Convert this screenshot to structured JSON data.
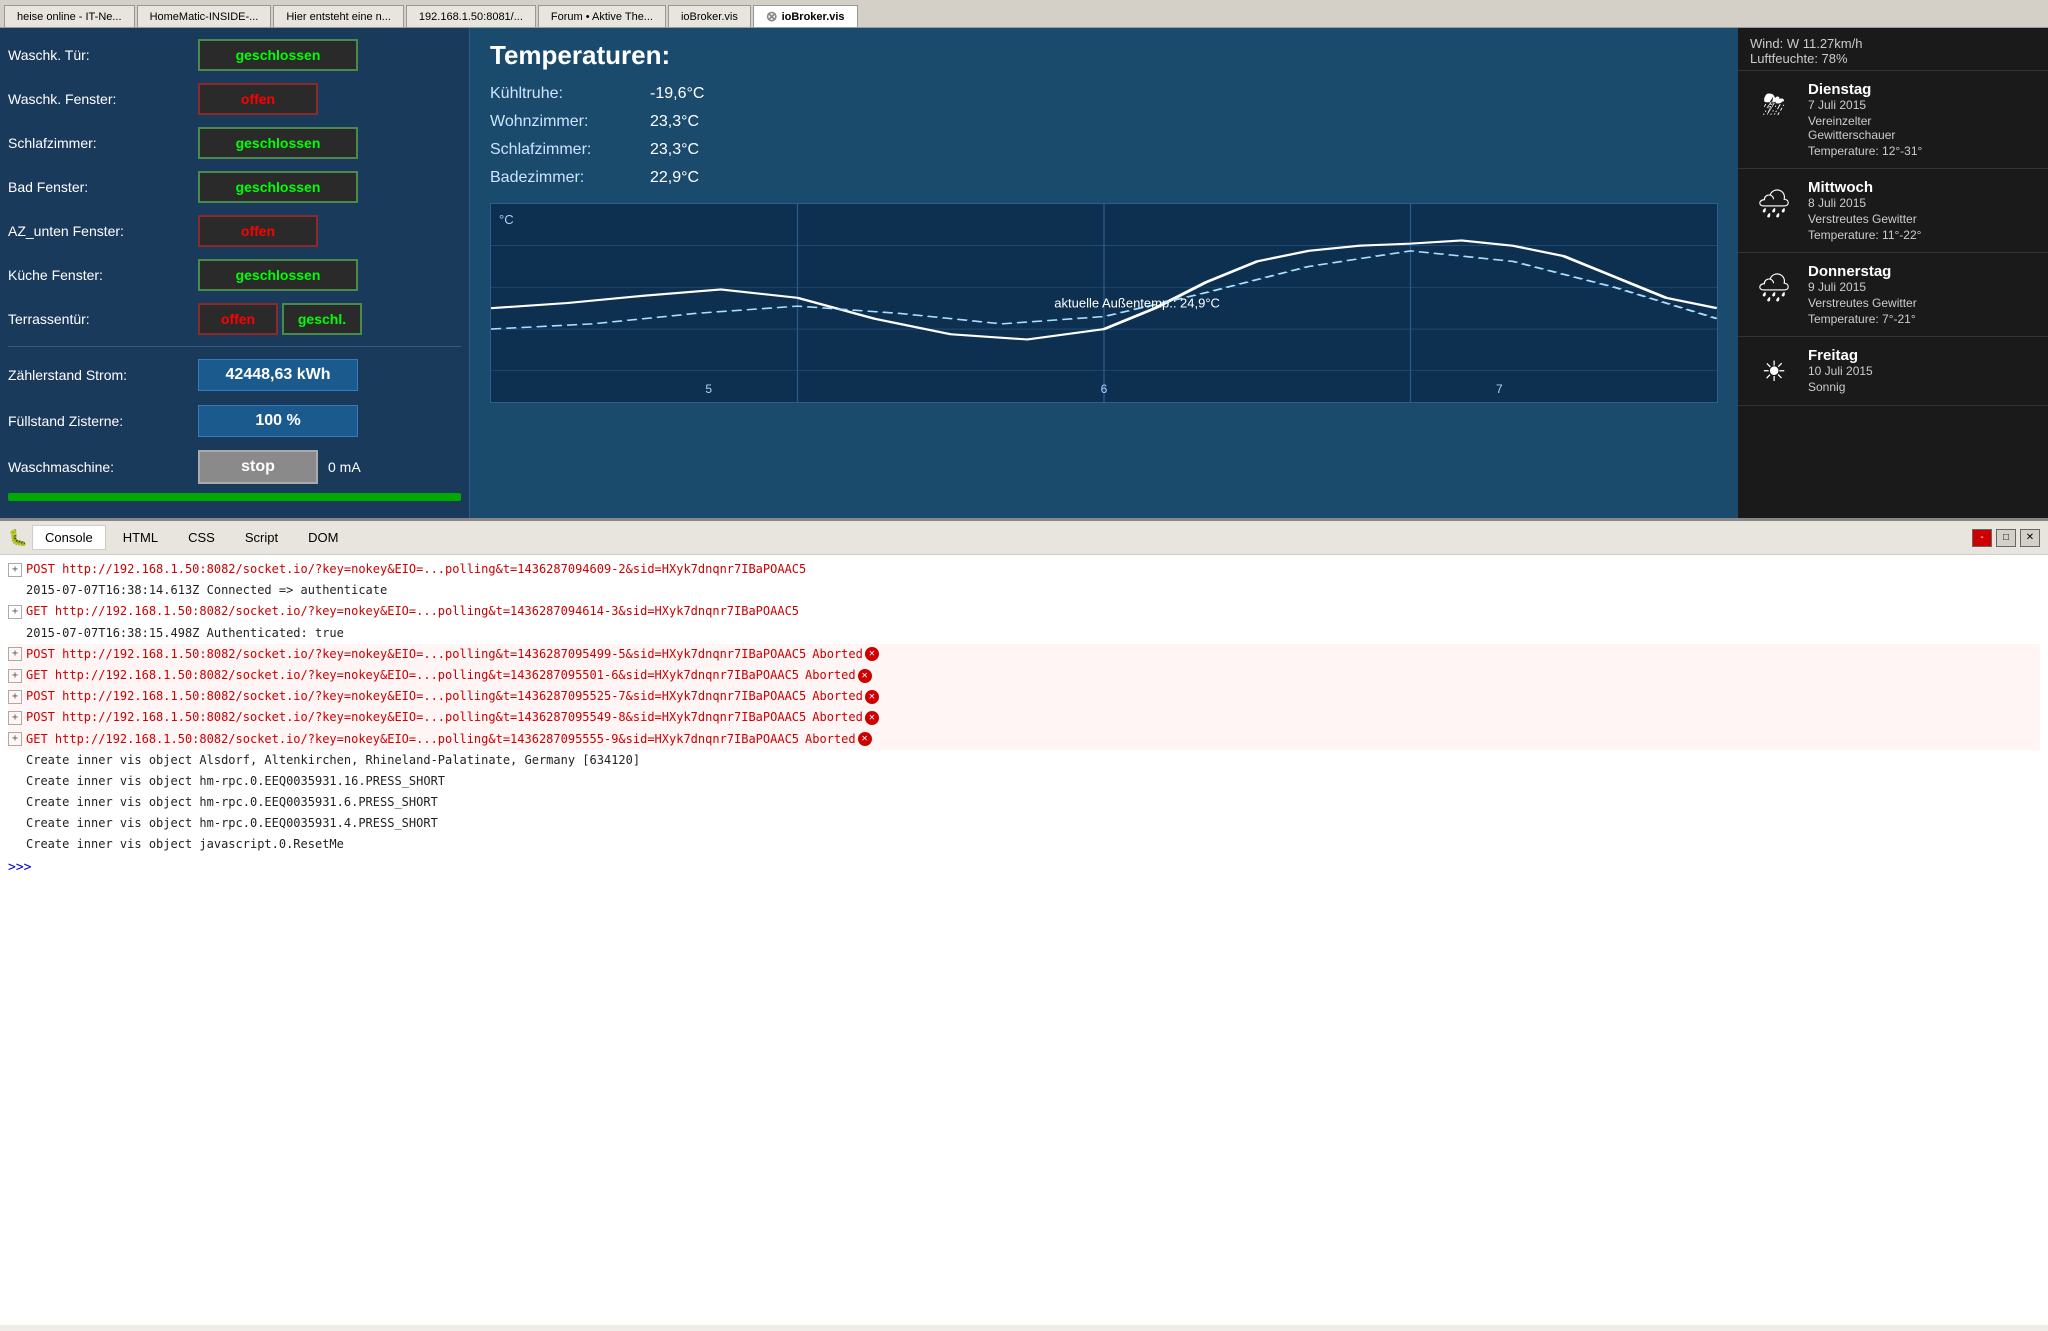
{
  "browser_tabs": [
    {
      "label": "heise online - IT-Ne...",
      "active": false
    },
    {
      "label": "HomeMatic-INSIDE-...",
      "active": false
    },
    {
      "label": "Hier entsteht eine n...",
      "active": false
    },
    {
      "label": "192.168.1.50:8081/...",
      "active": false
    },
    {
      "label": "Forum • Aktive The...",
      "active": false
    },
    {
      "label": "ioBroker.vis",
      "active": false
    },
    {
      "label": "ioBroker.vis",
      "active": true
    }
  ],
  "smart_home": {
    "controls": [
      {
        "label": "Waschk. Tür:",
        "status": "geschlossen",
        "type": "green"
      },
      {
        "label": "Waschk. Fenster:",
        "status": "offen",
        "type": "red"
      },
      {
        "label": "Schlafzimmer:",
        "status": "geschlossen",
        "type": "green"
      },
      {
        "label": "Bad Fenster:",
        "status": "geschlossen",
        "type": "green"
      },
      {
        "label": "AZ_unten Fenster:",
        "status": "offen",
        "type": "red"
      },
      {
        "label": "Küche Fenster:",
        "status": "geschlossen",
        "type": "green"
      },
      {
        "label": "Terrassentür:",
        "btn1": "offen",
        "btn1type": "red",
        "btn2": "geschl.",
        "btn2type": "green",
        "type": "pair"
      }
    ],
    "values": [
      {
        "label": "Zählerstand Strom:",
        "value": "42448,63 kWh"
      },
      {
        "label": "Füllstand Zisterne:",
        "value": "100 %"
      },
      {
        "label": "Waschmaschine:",
        "btn_label": "stop",
        "extra": "0 mA",
        "type": "stop"
      }
    ]
  },
  "temperatures": {
    "title": "Temperaturen:",
    "items": [
      {
        "name": "Kühltruhe:",
        "value": "-19,6°C"
      },
      {
        "name": "Wohnzimmer:",
        "value": "23,3°C"
      },
      {
        "name": "Schlafzimmer:",
        "value": "23,3°C"
      },
      {
        "name": "Badezimmer:",
        "value": "22,9°C"
      }
    ],
    "chart": {
      "y_label": "°C",
      "overlay_text": "aktuelle Außentemp.: 24,9°C",
      "x_labels": [
        "5",
        "6",
        "7"
      ]
    }
  },
  "weather": {
    "wind_line": "Wind: W 11.27km/h",
    "humidity_line": "Luftfeuchte: 78%",
    "days": [
      {
        "name": "Dienstag",
        "date": "7 Juli 2015",
        "desc": "Vereinzelter\nGewitterschauer",
        "temp": "Temperature: 12°-31°",
        "icon": "⛈"
      },
      {
        "name": "Mittwoch",
        "date": "8 Juli 2015",
        "desc": "Verstreutes Gewitter",
        "temp": "Temperature: 11°-22°",
        "icon": "🌧"
      },
      {
        "name": "Donnerstag",
        "date": "9 Juli 2015",
        "desc": "Verstreutes Gewitter",
        "temp": "Temperature: 7°-21°",
        "icon": "🌧"
      },
      {
        "name": "Freitag",
        "date": "10 Juli 2015",
        "desc": "Sonnig",
        "temp": "",
        "icon": "☀"
      }
    ]
  },
  "devtools": {
    "tabs": [
      "Console",
      "HTML",
      "CSS",
      "Script",
      "DOM"
    ],
    "active_tab": "Console",
    "window_buttons": [
      "-",
      "□",
      "✕"
    ],
    "log_entries": [
      {
        "type": "post",
        "method": "POST",
        "url": "http://192.168.1.50:8082/socket.io/?key=nokey&EIO=...polling&t=1436287094609-2&sid=HXyk7dnqnr7IBaPOAAC5",
        "aborted": false
      },
      {
        "type": "info",
        "text": "2015-07-07T16:38:14.613Z Connected => authenticate",
        "aborted": false
      },
      {
        "type": "get",
        "method": "GET",
        "url": "http://192.168.1.50:8082/socket.io/?key=nokey&EIO=...polling&t=1436287094614-3&sid=HXyk7dnqnr7IBaPOAAC5",
        "aborted": false
      },
      {
        "type": "info",
        "text": "2015-07-07T16:38:15.498Z Authenticated: true",
        "aborted": false
      },
      {
        "type": "post",
        "method": "POST",
        "url": "http://192.168.1.50:8082/socket.io/?key=nokey&EIO=...polling&t=1436287095499-5&sid=HXyk7dnqnr7IBaPOAAC5",
        "aborted": true
      },
      {
        "type": "get",
        "method": "GET",
        "url": "http://192.168.1.50:8082/socket.io/?key=nokey&EIO=...polling&t=1436287095501-6&sid=HXyk7dnqnr7IBaPOAAC5",
        "aborted": true
      },
      {
        "type": "post",
        "method": "POST",
        "url": "http://192.168.1.50:8082/socket.io/?key=nokey&EIO=...polling&t=1436287095525-7&sid=HXyk7dnqnr7IBaPOAAC5",
        "aborted": true
      },
      {
        "type": "post",
        "method": "POST",
        "url": "http://192.168.1.50:8082/socket.io/?key=nokey&EIO=...polling&t=1436287095549-8&sid=HXyk7dnqnr7IBaPOAAC5",
        "aborted": true
      },
      {
        "type": "get",
        "method": "GET",
        "url": "http://192.168.1.50:8082/socket.io/?key=nokey&EIO=...polling&t=1436287095555-9&sid=HXyk7dnqnr7IBaPOAAC5",
        "aborted": true
      },
      {
        "type": "info",
        "text": "Create inner vis object Alsdorf, Altenkirchen, Rhineland-Palatinate, Germany [634120]",
        "aborted": false
      },
      {
        "type": "info",
        "text": "Create inner vis object hm-rpc.0.EEQ0035931.16.PRESS_SHORT",
        "aborted": false
      },
      {
        "type": "info",
        "text": "Create inner vis object hm-rpc.0.EEQ0035931.6.PRESS_SHORT",
        "aborted": false
      },
      {
        "type": "info",
        "text": "Create inner vis object hm-rpc.0.EEQ0035931.4.PRESS_SHORT",
        "aborted": false
      },
      {
        "type": "info",
        "text": "Create inner vis object javascript.0.ResetMe",
        "aborted": false
      }
    ],
    "prompt": ">>>"
  }
}
